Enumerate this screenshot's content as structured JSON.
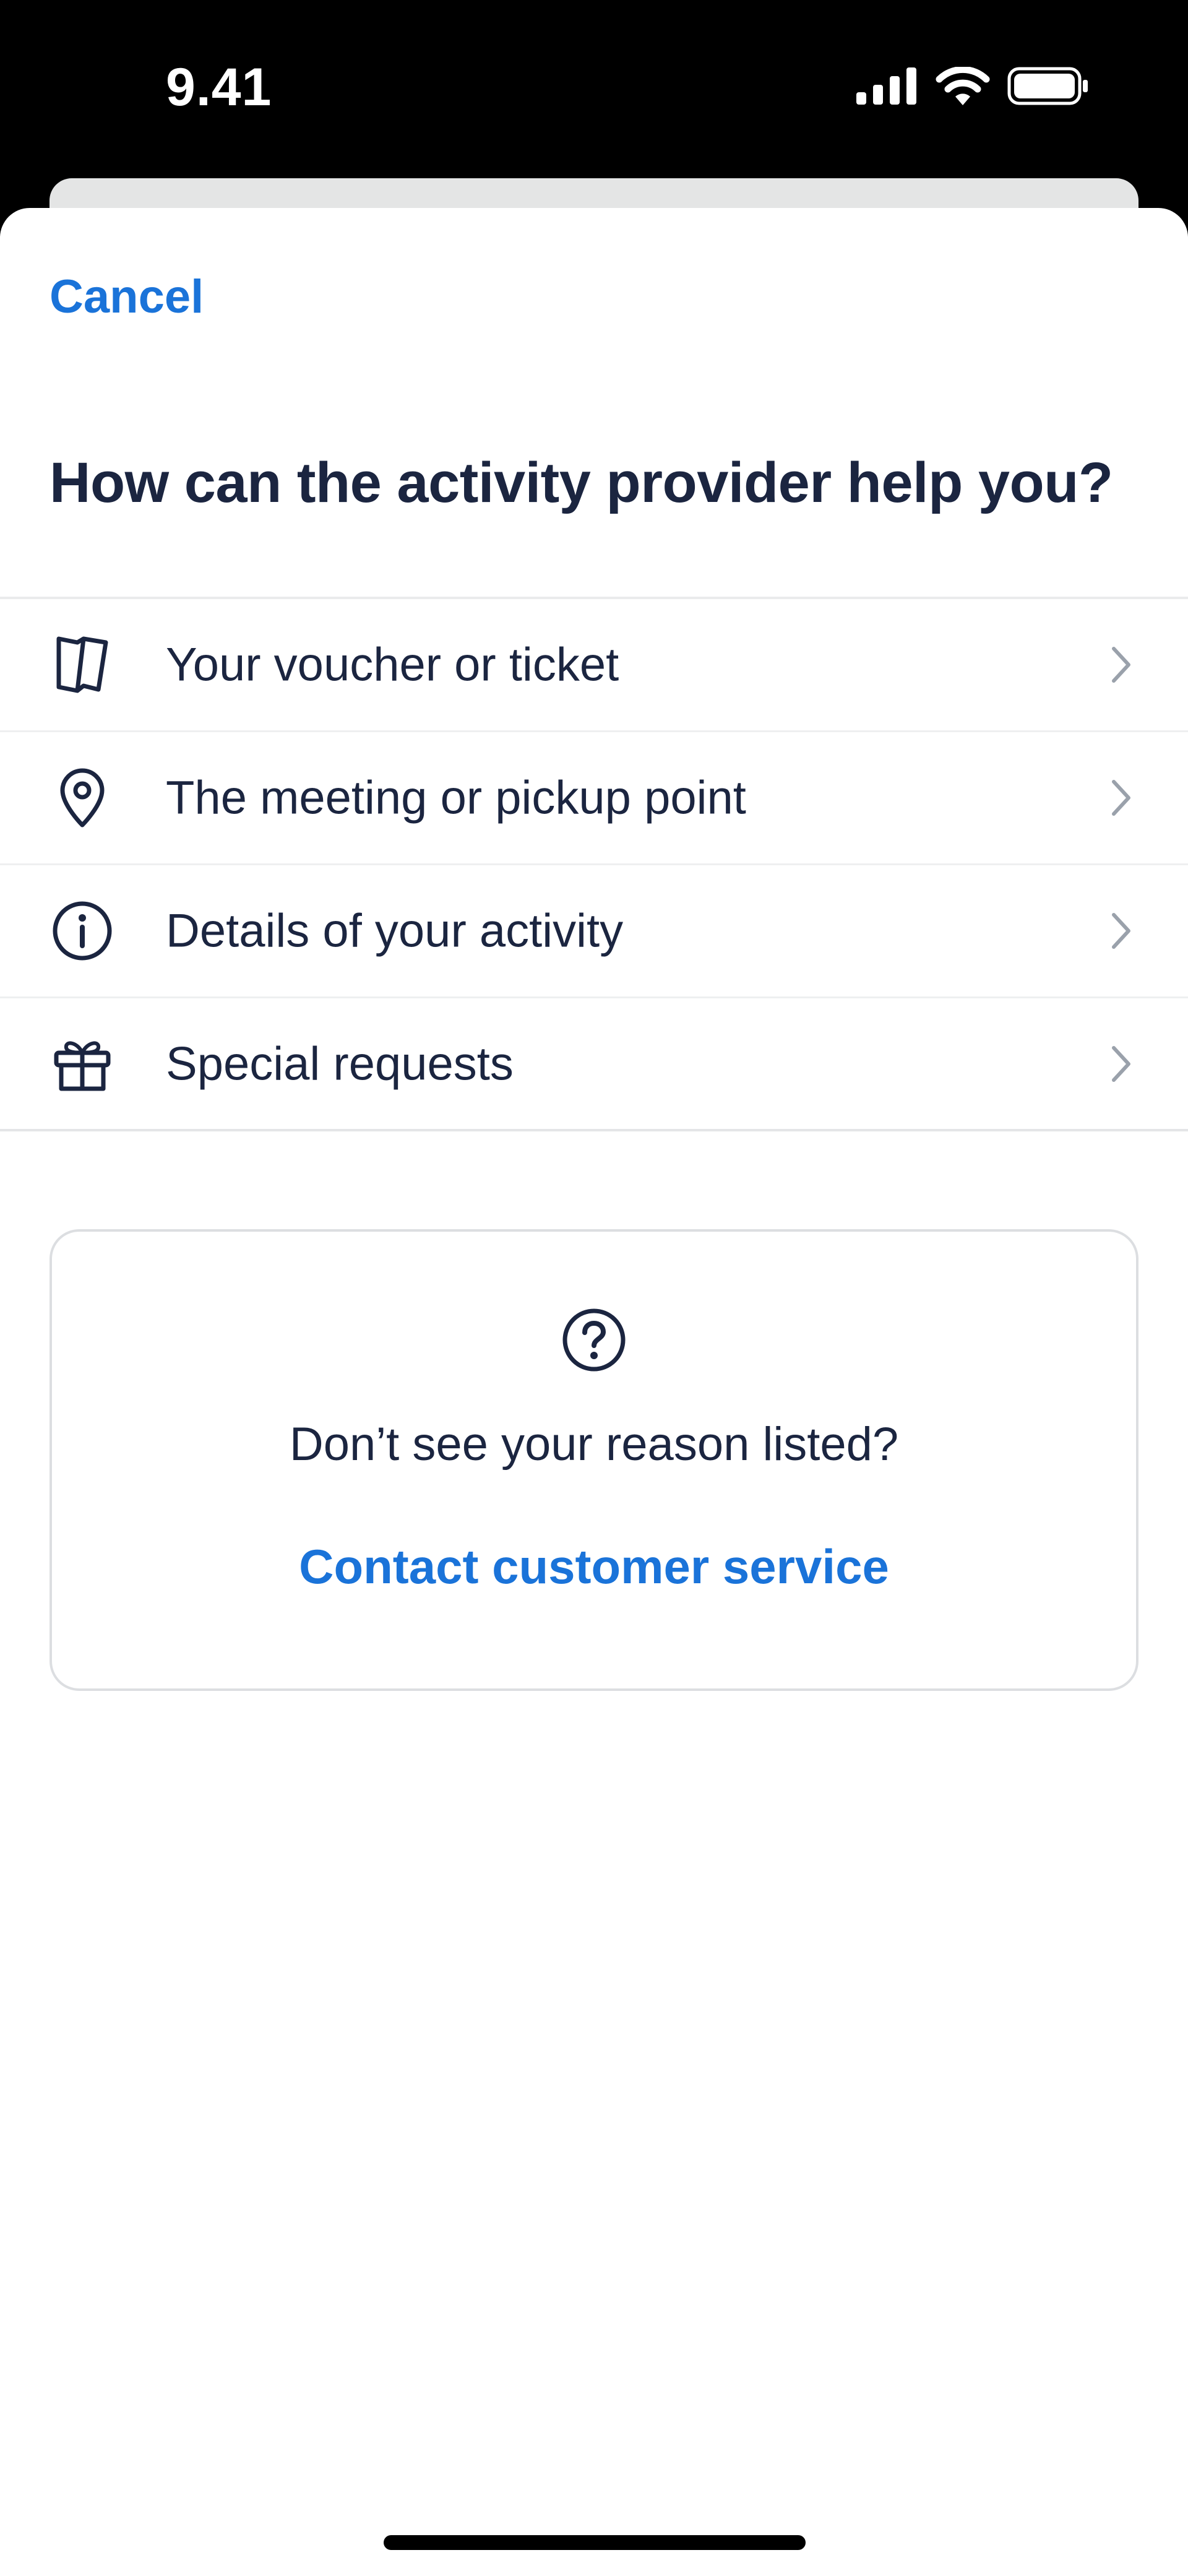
{
  "status_bar": {
    "time": "9.41",
    "icons": [
      "cellular-signal-icon",
      "wifi-icon",
      "battery-icon"
    ]
  },
  "sheet": {
    "cancel_label": "Cancel",
    "title": "How can the activity provider help you?",
    "options": [
      {
        "label": "Your voucher or ticket",
        "icon": "ticket-icon"
      },
      {
        "label": "The meeting or pickup point",
        "icon": "location-pin-icon"
      },
      {
        "label": "Details of your activity",
        "icon": "info-icon"
      },
      {
        "label": "Special requests",
        "icon": "gift-icon"
      }
    ],
    "help_card": {
      "icon": "question-mark-icon",
      "text": "Don’t see your reason listed?",
      "link_label": "Contact customer service"
    }
  },
  "colors": {
    "accent": "#1a73d9",
    "text_primary": "#1b2540",
    "divider": "#eeeff0",
    "chevron": "#9aa1ab",
    "status_bar_bg": "#000000"
  }
}
